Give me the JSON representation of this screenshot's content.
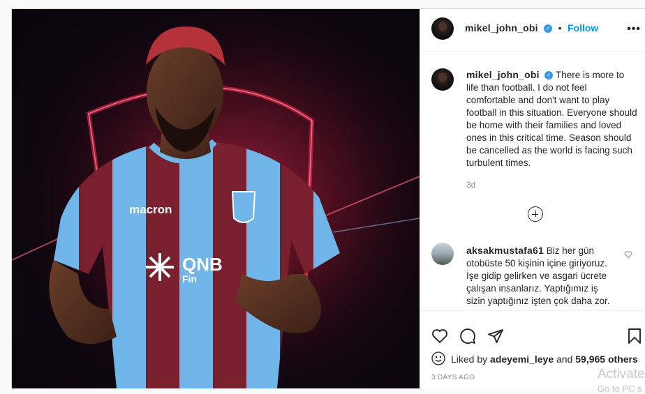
{
  "post": {
    "author": "mikel_john_obi",
    "follow_label": "Follow",
    "separator": "•",
    "more_label": "•••",
    "caption": "There is more to life than football. I do not feel comfortable and don't want to play football in this situation. Everyone should be home with their families and loved ones in this critical time. Season should be cancelled as the world is facing such turbulent times.",
    "caption_age": "3d",
    "likes_prefix": "Liked by",
    "liked_by_user": "adeyemi_leye",
    "likes_conjunction": "and",
    "likes_count": "59,965 others",
    "posted_time": "3 DAYS AGO"
  },
  "photo": {
    "jersey_brand": "macron",
    "jersey_sponsor": "QNB",
    "jersey_sponsor_sub": "Fin"
  },
  "comments": [
    {
      "user": "aksakmustafa61",
      "text": "Biz her gün otobüste 50 kişinin içine giriyoruz. İşe gidip gelirken ve asgari ücrete çalışan insanlarız. Yaptığımız iş sizin yaptığınız işten çok daha zor."
    }
  ],
  "watermark": {
    "line1": "Activate",
    "line2": "Go to PC s"
  },
  "colors": {
    "accent": "#0095f6",
    "verified": "#3897f0",
    "jersey_maroon": "#7a1f2e",
    "jersey_blue": "#6fb5e8"
  },
  "icons": [
    "verified-icon",
    "more-options-icon",
    "load-more-comments-icon",
    "comment-like-icon",
    "like-heart-icon",
    "comment-icon",
    "share-icon",
    "save-bookmark-icon",
    "liker-avatar-icon"
  ]
}
